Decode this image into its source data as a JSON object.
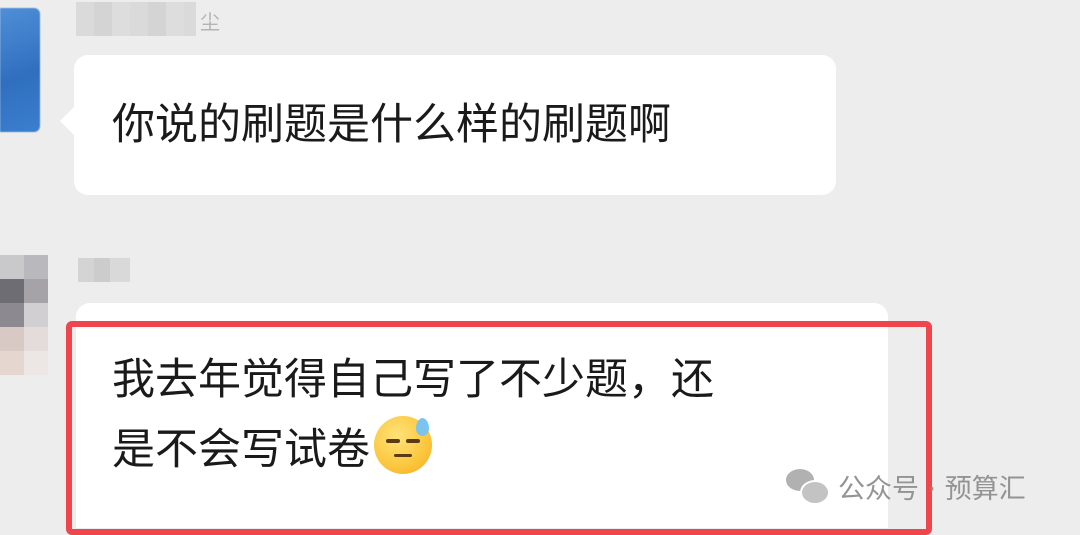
{
  "messages": [
    {
      "text": "你说的刷题是什么样的刷题啊"
    },
    {
      "text": "我去年觉得自己写了不少题，还\n是不会写试卷"
    }
  ],
  "sender1_name_tail": "尘",
  "watermark": {
    "text": "公众号 · 预算汇",
    "icon": "wechat-official-account-icon"
  },
  "emoji": "sleepy-sweat-face-emoji",
  "colors": {
    "background": "#ededed",
    "bubble": "#ffffff",
    "highlight": "#f0454c"
  }
}
